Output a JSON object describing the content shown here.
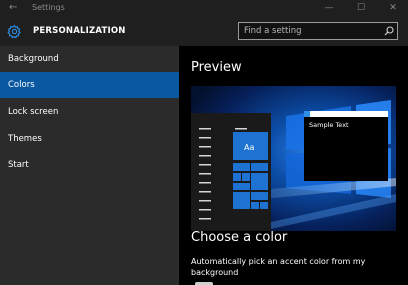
{
  "titlebar": {
    "back_glyph": "←",
    "title": "Settings",
    "minimize_glyph": "—",
    "maximize_glyph": "☐",
    "close_glyph": "✕"
  },
  "header": {
    "icon": "gear-icon",
    "title": "PERSONALIZATION"
  },
  "search": {
    "placeholder": "Find a setting",
    "icon": "search-icon"
  },
  "sidebar": {
    "items": [
      {
        "label": "Background",
        "selected": false
      },
      {
        "label": "Colors",
        "selected": true
      },
      {
        "label": "Lock screen",
        "selected": false
      },
      {
        "label": "Themes",
        "selected": false
      },
      {
        "label": "Start",
        "selected": false
      }
    ]
  },
  "main": {
    "preview_heading": "Preview",
    "preview": {
      "tile_label": "Aa",
      "window_text": "Sample Text"
    },
    "choose_heading": "Choose a color",
    "auto_accent_text": "Automatically pick an accent color from my background"
  },
  "colors": {
    "accent": "#0a58a0",
    "tile_blue": "#1e73d2",
    "sidebar_bg": "#2b2b2b",
    "header_bg": "#1f1f1f"
  }
}
